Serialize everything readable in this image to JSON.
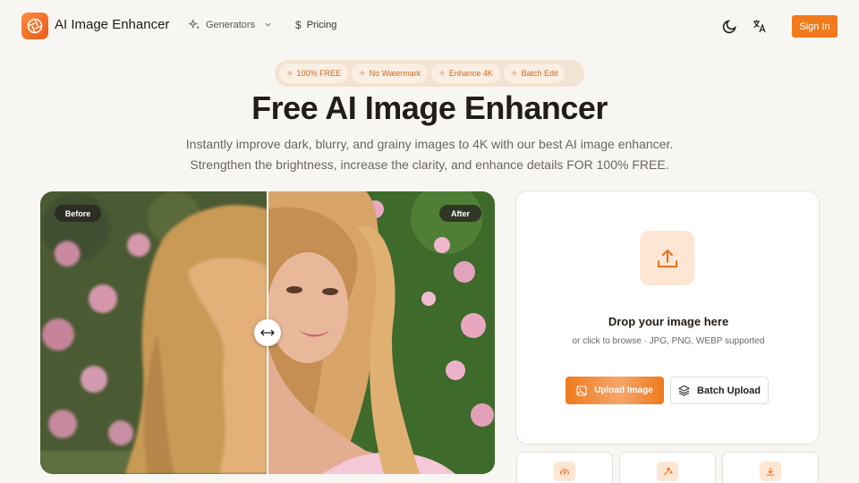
{
  "header": {
    "brand": "AI Image Enhancer",
    "nav": {
      "generators": "Generators",
      "pricing": "Pricing"
    },
    "sign_in": "Sign In"
  },
  "badges": [
    "100% FREE",
    "No Watermark",
    "Enhance 4K",
    "Batch Edit"
  ],
  "hero": {
    "title": "Free AI Image Enhancer",
    "subtitle_line1": "Instantly improve dark, blurry, and grainy images to 4K with our best AI image enhancer.",
    "subtitle_line2": "Strengthen the brightness, increase the clarity, and enhance details FOR 100% FREE."
  },
  "compare": {
    "before_label": "Before",
    "after_label": "After",
    "split": 0.5
  },
  "upload": {
    "title": "Drop your image here",
    "subtitle": "or click to browse · JPG, PNG, WEBP supported",
    "upload_button": "Upload Image",
    "batch_button": "Batch Upload"
  },
  "icons": [
    "logo-aperture-icon",
    "sparkles-icon",
    "chevron-down-icon",
    "dollar-icon",
    "moon-icon",
    "translate-icon",
    "upload-icon",
    "image-icon",
    "layers-icon",
    "cloud-upload-icon",
    "magic-wand-icon",
    "download-icon",
    "arrows-horizontal-icon"
  ],
  "colors": {
    "accent": "#f07a1c",
    "accent_light": "#fde6d4",
    "background": "#f8f6f2"
  }
}
